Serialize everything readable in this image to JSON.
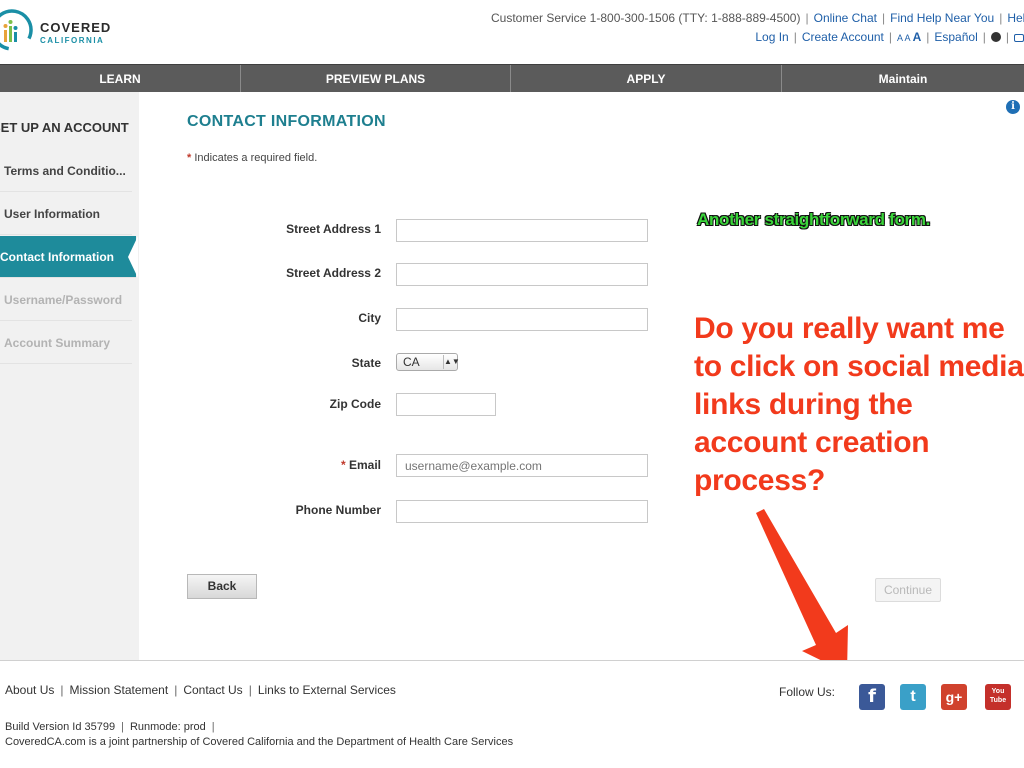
{
  "header": {
    "logo_line1": "COVERED",
    "logo_line2": "CALIFORNIA",
    "customer_service": "Customer Service 1-800-300-1506 (TTY: 1-888-889-4500)",
    "online_chat": "Online Chat",
    "find_help": "Find Help Near You",
    "help": "Help",
    "login": "Log In",
    "create_account": "Create Account",
    "text_size_small": "A A",
    "text_size_large": "A",
    "espanol": "Español"
  },
  "nav": {
    "items": [
      {
        "label": "LEARN"
      },
      {
        "label": "PREVIEW PLANS"
      },
      {
        "label": "APPLY"
      },
      {
        "label": "Maintain"
      }
    ]
  },
  "sidebar": {
    "title": "SET UP AN ACCOUNT",
    "items": [
      {
        "label": "Terms and Conditio...",
        "state": "done"
      },
      {
        "label": "User Information",
        "state": "done"
      },
      {
        "label": "Contact Information",
        "state": "active"
      },
      {
        "label": "Username/Password",
        "state": "disabled"
      },
      {
        "label": "Account Summary",
        "state": "disabled"
      }
    ]
  },
  "form": {
    "title": "CONTACT INFORMATION",
    "required_note": "Indicates a required field.",
    "required_star": "*",
    "street1_label": "Street Address 1",
    "street2_label": "Street Address 2",
    "city_label": "City",
    "state_label": "State",
    "state_value": "CA",
    "zip_label": "Zip Code",
    "email_label": "Email",
    "email_placeholder": "username@example.com",
    "phone_label": "Phone Number",
    "back_label": "Back",
    "continue_label": "Continue"
  },
  "annotations": {
    "green_note": "Another straightforward form.",
    "red_note": "Do you really want me to click on social media links during the account creation process?"
  },
  "footer": {
    "links": [
      "About Us",
      "Mission Statement",
      "Contact Us",
      "Links to External Services"
    ],
    "build": "Build Version Id 35799",
    "runmode": "Runmode: prod",
    "partnership": "CoveredCA.com is a joint partnership of Covered California and the Department of Health Care Services",
    "follow_us": "Follow Us:",
    "social": {
      "facebook": "f",
      "twitter": "t",
      "google_plus": "g+",
      "youtube_top": "You",
      "youtube_bottom": "Tube"
    }
  },
  "colors": {
    "teal": "#1e8b9b",
    "nav_bg": "#5b5b5b",
    "annotation_red": "#f23a1c",
    "annotation_green": "#3ad43a"
  }
}
